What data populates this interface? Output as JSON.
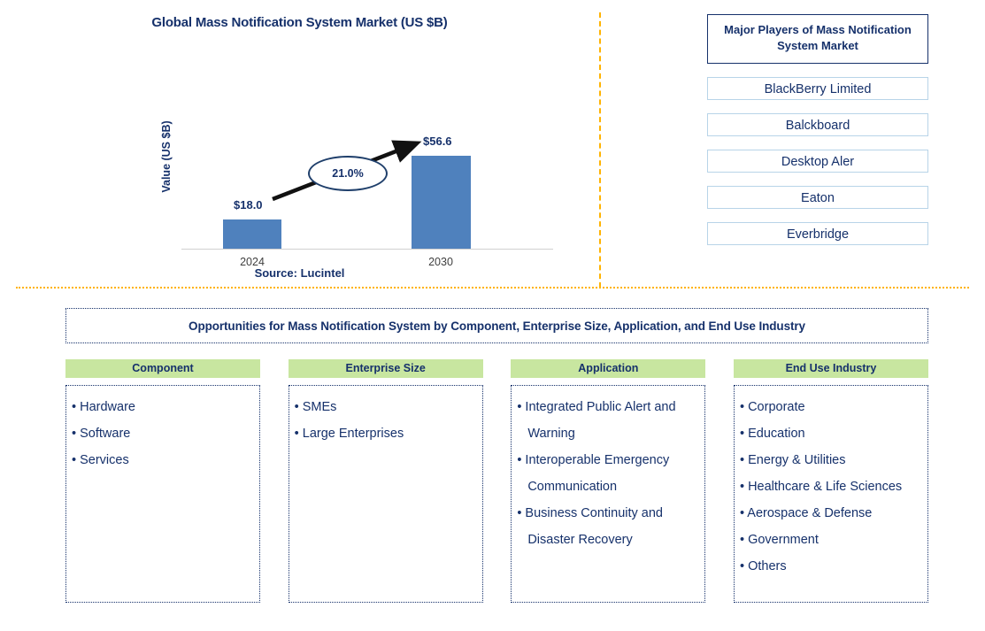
{
  "chart": {
    "title": "Global Mass Notification System Market (US $B)",
    "source": "Source: Lucintel"
  },
  "chart_data": {
    "type": "bar",
    "title": "Global Mass Notification System Market (US $B)",
    "categories": [
      "2024",
      "2030"
    ],
    "values": [
      18.0,
      56.6
    ],
    "value_labels": [
      "$18.0",
      "$56.6"
    ],
    "xlabel": "",
    "ylabel": "Value (US $B)",
    "ylim": [
      0,
      62
    ],
    "grid": false,
    "legend": null,
    "annotations": [
      {
        "label": "21.0%",
        "type": "cagr-callout",
        "from": "2024",
        "to": "2030"
      }
    ],
    "bar_color": "#4f81bd",
    "text_color": "#16316b",
    "source": "Source: Lucintel"
  },
  "players": {
    "header": "Major Players of Mass Notification System Market",
    "items": [
      "BlackBerry Limited",
      "Balckboard",
      "Desktop Aler",
      "Eaton",
      "Everbridge"
    ]
  },
  "opportunities": {
    "banner": "Opportunities for Mass Notification System by Component, Enterprise Size, Application, and End Use Industry",
    "columns": [
      {
        "header": "Component",
        "items": [
          "Hardware",
          "Software",
          "Services"
        ]
      },
      {
        "header": "Enterprise Size",
        "items": [
          "SMEs",
          "Large Enterprises"
        ]
      },
      {
        "header": "Application",
        "items": [
          "Integrated Public Alert and Warning",
          "Interoperable Emergency Communication",
          "Business Continuity and Disaster Recovery"
        ]
      },
      {
        "header": "End Use Industry",
        "items": [
          "Corporate",
          "Education",
          "Energy & Utilities",
          "Healthcare & Life Sciences",
          "Aerospace & Defense",
          "Government",
          "Others"
        ]
      }
    ]
  },
  "colors": {
    "accent_navy": "#16316b",
    "bar_blue": "#4f81bd",
    "header_green": "#c8e6a0",
    "divider_orange": "#ffb300",
    "player_border": "#b8d4e8"
  }
}
